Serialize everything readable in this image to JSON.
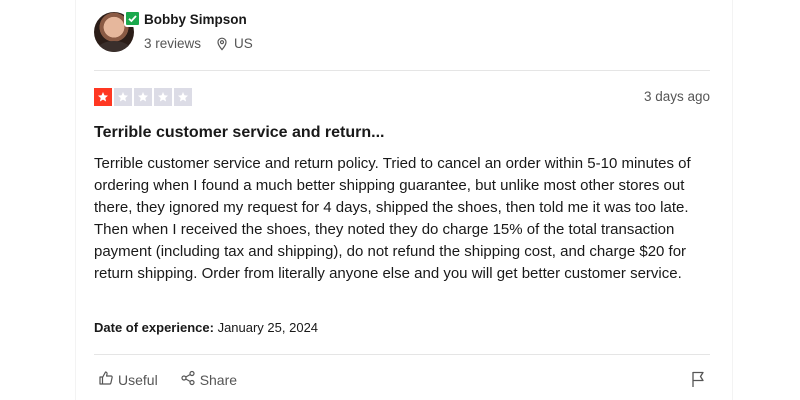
{
  "reviewer": {
    "name": "Bobby Simpson",
    "reviews": "3 reviews",
    "country": "US"
  },
  "review": {
    "rating": 1,
    "max_rating": 5,
    "relative_date": "3 days ago",
    "title": "Terrible customer service and return...",
    "body": "Terrible customer service and return policy. Tried to cancel an order within 5-10 minutes of ordering when I found a much better shipping guarantee, but unlike most other stores out there, they ignored my request for 4 days, shipped the shoes, then told me it was too late. Then when I received the shoes, they noted they do charge 15% of the total transaction payment (including tax and shipping), do not refund the shipping cost, and charge $20 for return shipping. Order from literally anyone else and you will get better customer service.",
    "experience_label": "Date of experience:",
    "experience_date": "January 25, 2024"
  },
  "actions": {
    "useful_label": "Useful",
    "share_label": "Share"
  },
  "colors": {
    "star_filled": "#ff3722",
    "star_empty": "#dcdce6",
    "verified": "#1aa84c"
  },
  "icons": [
    "verified-badge-icon",
    "location-pin-icon",
    "star-icon",
    "thumbs-up-icon",
    "share-icon",
    "flag-icon"
  ]
}
